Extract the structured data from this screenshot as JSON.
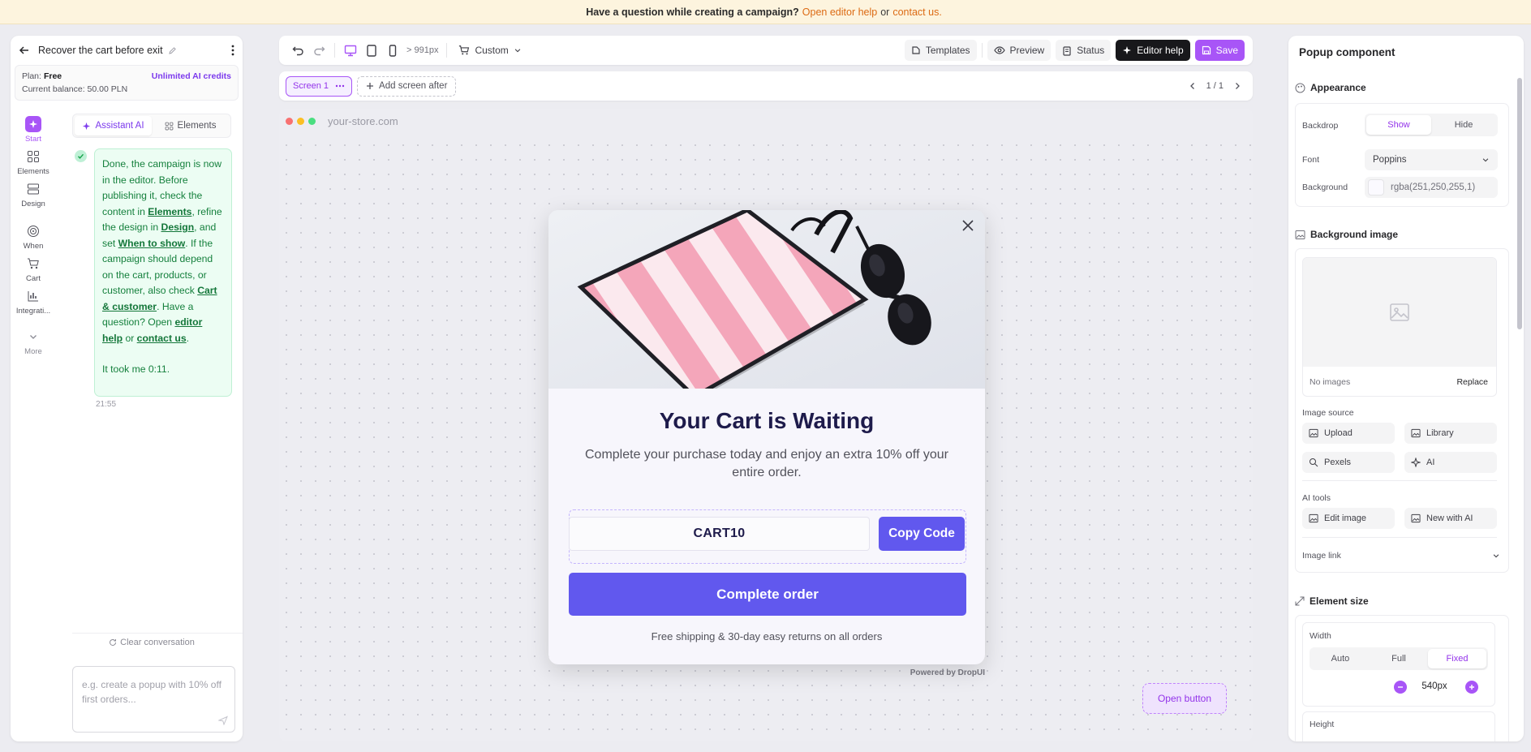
{
  "banner": {
    "question": "Have a question while creating a campaign?",
    "link1": "Open editor help",
    "or": "or",
    "link2": "contact us."
  },
  "left_panel": {
    "title": "Recover the cart before exit",
    "plan_label": "Plan:",
    "plan_value": "Free",
    "credits": "Unlimited AI credits",
    "balance": "Current balance: 50.00 PLN",
    "rail": [
      {
        "label": "Start",
        "icon": "sparkle-icon"
      },
      {
        "label": "Elements",
        "icon": "grid-icon"
      },
      {
        "label": "Design",
        "icon": "layout-icon"
      },
      {
        "label": "When",
        "icon": "target-icon"
      },
      {
        "label": "Cart",
        "icon": "cart-icon"
      },
      {
        "label": "Integrati...",
        "icon": "chart-icon"
      },
      {
        "label": "More",
        "icon": "chevron-down-icon"
      }
    ],
    "tabs": [
      "Assistant AI",
      "Elements"
    ],
    "chat": {
      "t1": "Done, the campaign is now in the editor. Before publishing it, check the content in ",
      "l1": "Elements",
      "t2": ", refine the design in ",
      "l2": "Design",
      "t3": ", and set ",
      "l3": "When to show",
      "t4": ". If the campaign should depend on the cart, products, or customer, also check ",
      "l4": "Cart & customer",
      "t5": ". Have a question? Open ",
      "l5": "editor help",
      "t6": " or ",
      "l6": "contact us",
      "t7": ".",
      "took": "It took me 0:11.",
      "time": "21:55"
    },
    "clear": "Clear conversation",
    "prompt_placeholder": "e.g. create a popup with 10% off first orders..."
  },
  "toolbar": {
    "breakpoint": "> 991px",
    "cart_mode": "Custom",
    "templates": "Templates",
    "preview": "Preview",
    "status": "Status",
    "editor_help": "Editor help",
    "save": "Save"
  },
  "screenbar": {
    "screen": "Screen 1",
    "add": "Add screen after",
    "page": "1 / 1"
  },
  "canvas": {
    "url": "your-store.com",
    "popup": {
      "title": "Your Cart is Waiting",
      "subtitle": "Complete your purchase today and enjoy an extra 10% off your entire order.",
      "code": "CART10",
      "copy": "Copy Code",
      "cta": "Complete order",
      "footer": "Free shipping & 30-day easy returns on all orders"
    },
    "powered": "Powered by DropUI",
    "open_button": "Open button"
  },
  "right_panel": {
    "title": "Popup component",
    "appearance": {
      "heading": "Appearance",
      "backdrop_label": "Backdrop",
      "backdrop_options": [
        "Show",
        "Hide"
      ],
      "font_label": "Font",
      "font_value": "Poppins",
      "bg_label": "Background",
      "bg_value": "rgba(251,250,255,1)"
    },
    "bg_image": {
      "heading": "Background image",
      "no_images": "No images",
      "replace": "Replace",
      "source_label": "Image source",
      "sources": [
        "Upload",
        "Library",
        "Pexels",
        "AI"
      ],
      "ai_tools_label": "AI tools",
      "ai_tools": [
        "Edit image",
        "New with AI"
      ],
      "link_label": "Image link"
    },
    "size": {
      "heading": "Element size",
      "width_label": "Width",
      "width_options": [
        "Auto",
        "Full",
        "Fixed"
      ],
      "width_value": "540px",
      "height_label": "Height"
    }
  },
  "colors": {
    "accent": "#a855f7",
    "primary_button": "#6158ee",
    "banner_bg": "#fdf4de",
    "chat_bg": "#ecfdf3"
  }
}
